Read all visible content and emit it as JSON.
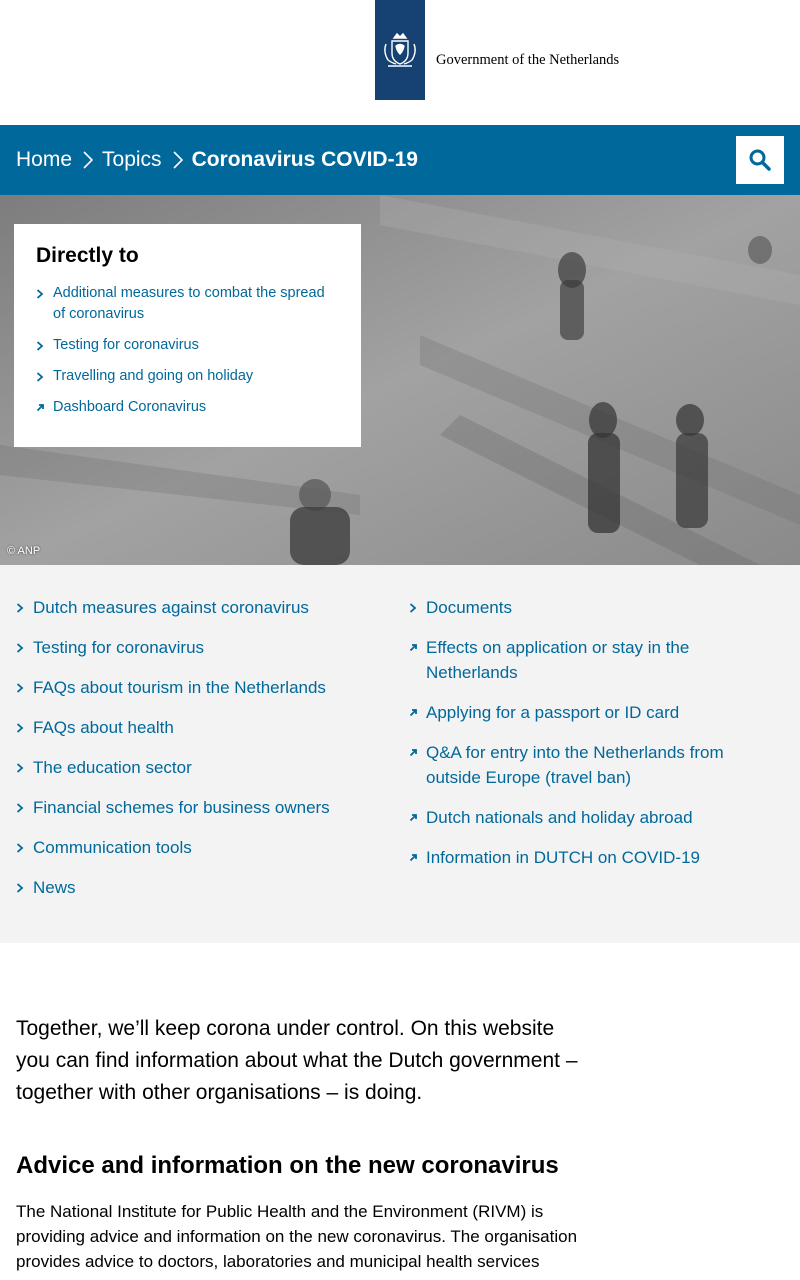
{
  "header": {
    "logo_text": "Government of the Netherlands",
    "logo_icon": "coat-of-arms-icon"
  },
  "breadcrumb": {
    "home": "Home",
    "topics": "Topics",
    "current": "Coronavirus COVID-19"
  },
  "search": {
    "icon": "search-icon"
  },
  "hero": {
    "credit": "© ANP",
    "directly_to": {
      "title": "Directly to",
      "items": [
        {
          "label": "Additional measures to combat the spread of coronavirus",
          "icon": "chevron-right-icon"
        },
        {
          "label": "Testing for coronavirus",
          "icon": "chevron-right-icon"
        },
        {
          "label": "Travelling and going on holiday",
          "icon": "chevron-right-icon"
        },
        {
          "label": "Dashboard Coronavirus",
          "icon": "external-link-icon"
        }
      ]
    }
  },
  "links": {
    "left": [
      "Dutch measures against coronavirus",
      "Testing for coronavirus",
      "FAQs about tourism in the Netherlands",
      "FAQs about health",
      "The education sector",
      "Financial schemes for business owners",
      "Communication tools",
      "News"
    ],
    "right": [
      {
        "label": "Documents",
        "icon": "chevron-right-icon"
      },
      {
        "label": "Effects on application or stay in the Netherlands",
        "icon": "external-link-icon"
      },
      {
        "label": "Applying for a passport or ID card",
        "icon": "external-link-icon"
      },
      {
        "label": "Q&A for entry into the Netherlands from outside Europe (travel ban)",
        "icon": "external-link-icon"
      },
      {
        "label": "Dutch nationals and holiday abroad",
        "icon": "external-link-icon"
      },
      {
        "label": "Information in DUTCH on COVID-19",
        "icon": "external-link-icon"
      }
    ]
  },
  "intro": "Together, we’ll keep corona under control. On this website you can find information about what the Dutch government – together with other organisations – is doing.",
  "advice": {
    "heading": "Advice and information on the new coronavirus",
    "text": "The National Institute for Public Health and the Environment (RIVM) is providing advice and information on the new coronavirus. The organisation provides advice to doctors, laboratories and municipal health services"
  },
  "colors": {
    "brand_blue": "#154273",
    "link_blue": "#01689b",
    "section_grey": "#f3f3f3"
  }
}
